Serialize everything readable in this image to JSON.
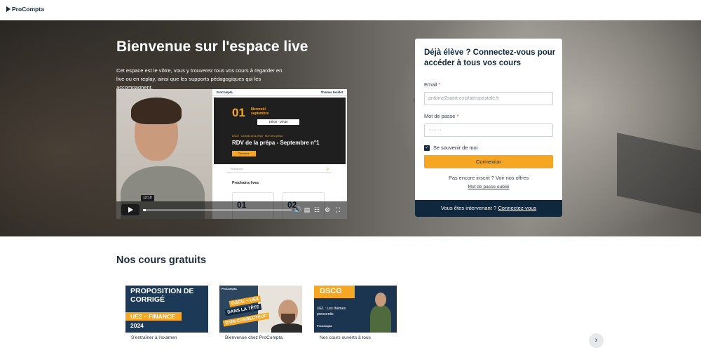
{
  "header": {
    "logo_text": "ProCompta"
  },
  "hero": {
    "title": "Bienvenue sur l'espace live",
    "description": "Cet espace est le vôtre, vous y trouverez tous vos cours à regarder en live ou en replay, ainsi que les supports pédagogiques qui les accompagnent."
  },
  "video": {
    "slide": {
      "brand": "ProCompta",
      "presenter": "Thomas Doullet",
      "day": "01",
      "month": "Mercredi septembre",
      "time": "19h00 - 19h30",
      "tags": "DSCG · Conseils de la prépa · RDV de la prépa",
      "heading": "RDV de la prépa - Septembre n°1",
      "button": "Découvrir",
      "search_placeholder": "Recherche",
      "next_title": "Prochains lives",
      "card1_day": "01",
      "card2_day": "02"
    },
    "current_time": "12:10",
    "progress": 0.02,
    "controls": {
      "play": "play-icon",
      "volume": "volume-icon",
      "captions": "captions-icon",
      "chapters": "chapters-icon",
      "settings": "settings-icon",
      "fullscreen": "fullscreen-icon"
    }
  },
  "login": {
    "title": "Déjà élève ? Connectez-vous pour accéder à tous vos cours",
    "email_label": "Email",
    "email_value": "antoine2saint-ex@aeropostale.fr",
    "password_label": "Mot de passe",
    "password_value": "········",
    "required_mark": "*",
    "remember_label": "Se souvenir de moi",
    "remember_checked": true,
    "submit": "Connexion",
    "signup_text": "Pas encore inscrit ? Voir nos offres",
    "forgot": "Mot de passe oublié",
    "footer_text": "Vous êtes intervenant ?",
    "footer_link": "Connectez-vous"
  },
  "courses": {
    "title": "Nos cours gratuits",
    "items": [
      {
        "thumb_title": "PROPOSITION DE CORRIGÉ",
        "thumb_band": "UE2 – FINANCE",
        "thumb_year": "2024",
        "caption": "S'entraîner à l'examen"
      },
      {
        "thumb_brand": "ProCompta",
        "thumb_tag1": "DSCG – UE4",
        "thumb_tag2": "DANS LA TÊTE",
        "thumb_tag3": "D'UN CORRECTEUR",
        "caption": "Bienvenue chez ProCompta"
      },
      {
        "thumb_title": "DSCG",
        "thumb_subtitle": "UE1 : Les thèmes pressentis",
        "thumb_brand": "ProCompta",
        "caption": "Nos cours ouverts à tous"
      }
    ],
    "next_button": "›"
  },
  "colors": {
    "navy": "#10283e",
    "accent": "#f5a623",
    "required": "#e0443a"
  }
}
